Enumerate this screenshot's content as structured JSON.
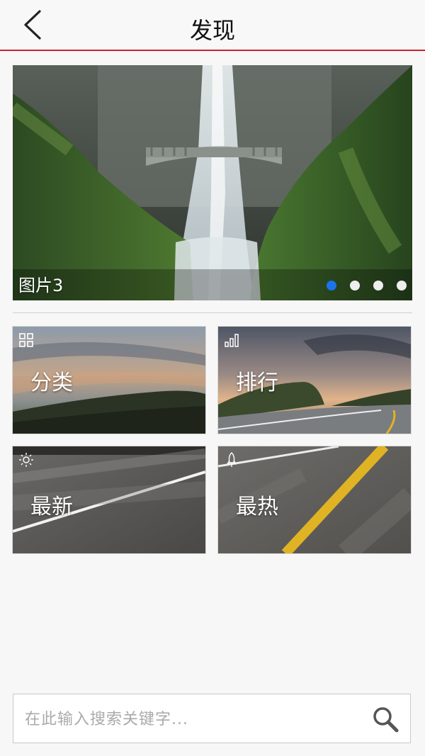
{
  "header": {
    "title": "发现"
  },
  "banner": {
    "caption": "图片3",
    "slide_count": 4,
    "active_slide": 1
  },
  "tiles": [
    {
      "label": "分类",
      "icon": "grid-icon"
    },
    {
      "label": "排行",
      "icon": "ranking-bars-icon"
    },
    {
      "label": "最新",
      "icon": "sun-icon"
    },
    {
      "label": "最热",
      "icon": "rocket-icon"
    }
  ],
  "search": {
    "placeholder": "在此输入搜索关键字..."
  },
  "colors": {
    "accent": "#c8232c",
    "active_dot": "#1a73e8"
  }
}
